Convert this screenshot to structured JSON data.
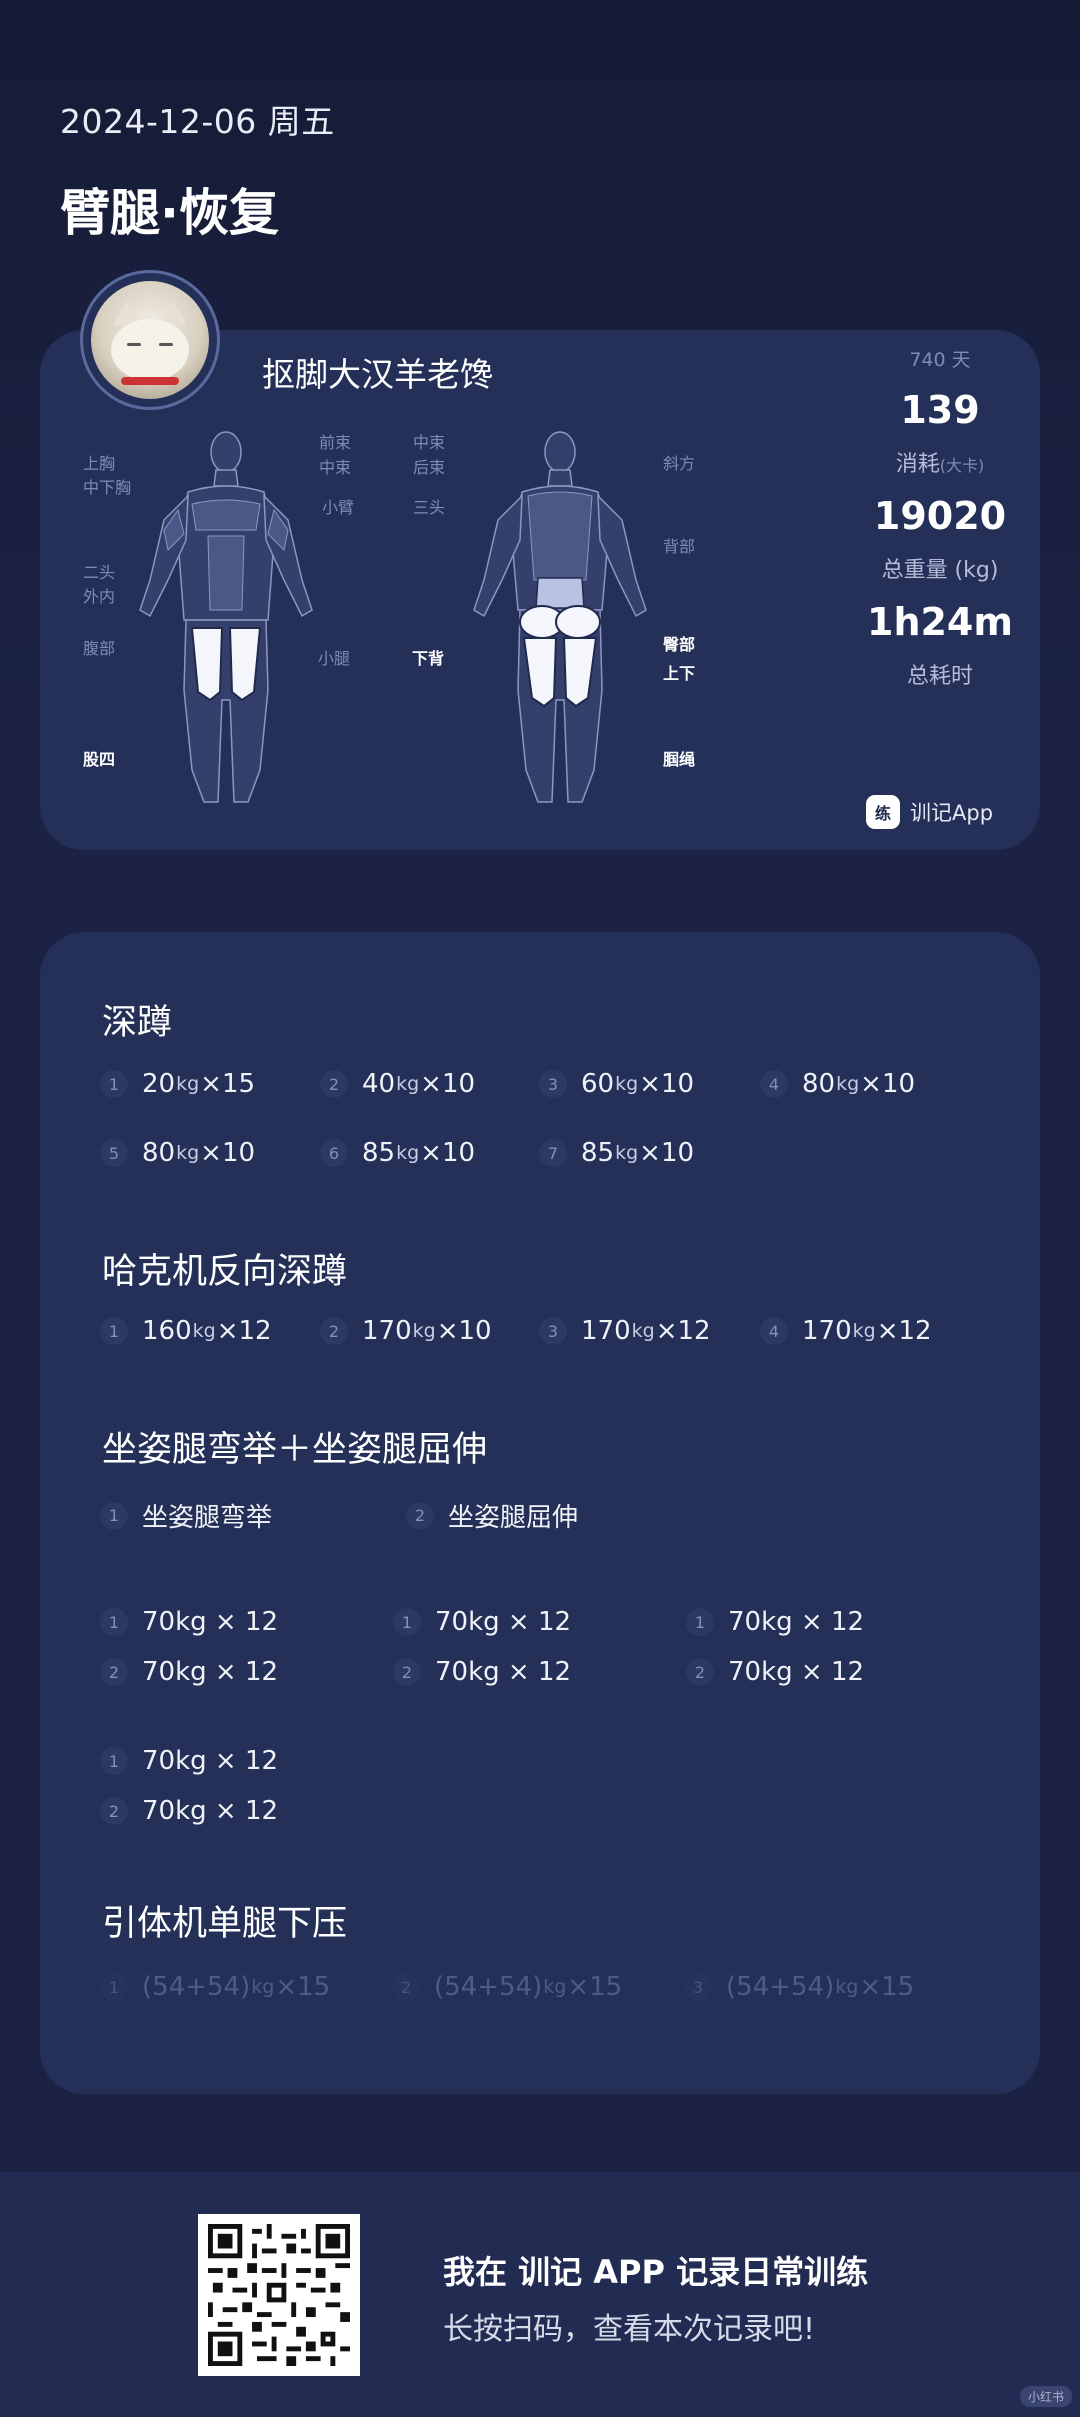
{
  "header": {
    "date": "2024-12-06 周五",
    "title": "臂腿·恢复"
  },
  "profile": {
    "username": "抠脚大汉羊老馋"
  },
  "muscle_labels": {
    "front_left": [
      "上胸",
      "中下胸",
      "二头",
      "外内",
      "腹部",
      "股四"
    ],
    "front_right": [
      "前束",
      "中束",
      "小臂",
      "小腿"
    ],
    "back_left": [
      "中束",
      "后束",
      "三头",
      "下背"
    ],
    "back_right": [
      "斜方",
      "背部",
      "臀部",
      "上下",
      "腘绳"
    ],
    "highlighted": [
      "股四",
      "下背",
      "臀部",
      "腘绳"
    ]
  },
  "stats": {
    "days": "740 天",
    "calories": "139",
    "calories_label": "消耗",
    "calories_unit": "(大卡)",
    "weight": "19020",
    "weight_label": "总重量 (kg)",
    "duration": "1h24m",
    "duration_label": "总耗时"
  },
  "brand": {
    "logo_text": "练",
    "name": "训记App"
  },
  "exercises": [
    {
      "title": "深蹲",
      "sets": [
        {
          "n": "1",
          "w": "20",
          "u": "kg",
          "r": "×15"
        },
        {
          "n": "2",
          "w": "40",
          "u": "kg",
          "r": "×10"
        },
        {
          "n": "3",
          "w": "60",
          "u": "kg",
          "r": "×10"
        },
        {
          "n": "4",
          "w": "80",
          "u": "kg",
          "r": "×10"
        },
        {
          "n": "5",
          "w": "80",
          "u": "kg",
          "r": "×10"
        },
        {
          "n": "6",
          "w": "85",
          "u": "kg",
          "r": "×10"
        },
        {
          "n": "7",
          "w": "85",
          "u": "kg",
          "r": "×10"
        }
      ]
    },
    {
      "title": "哈克机反向深蹲",
      "sets": [
        {
          "n": "1",
          "w": "160",
          "u": "kg",
          "r": "×12"
        },
        {
          "n": "2",
          "w": "170",
          "u": "kg",
          "r": "×10"
        },
        {
          "n": "3",
          "w": "170",
          "u": "kg",
          "r": "×12"
        },
        {
          "n": "4",
          "w": "170",
          "u": "kg",
          "r": "×12"
        }
      ]
    },
    {
      "title": "坐姿腿弯举＋坐姿腿屈伸",
      "sub_exercises": [
        {
          "n": "1",
          "name": "坐姿腿弯举"
        },
        {
          "n": "2",
          "name": "坐姿腿屈伸"
        }
      ],
      "groups": [
        [
          {
            "n": "1",
            "text": "70kg × 12"
          },
          {
            "n": "2",
            "text": "70kg × 12"
          }
        ],
        [
          {
            "n": "1",
            "text": "70kg × 12"
          },
          {
            "n": "2",
            "text": "70kg × 12"
          }
        ],
        [
          {
            "n": "1",
            "text": "70kg × 12"
          },
          {
            "n": "2",
            "text": "70kg × 12"
          }
        ],
        [
          {
            "n": "1",
            "text": "70kg × 12"
          },
          {
            "n": "2",
            "text": "70kg × 12"
          }
        ]
      ]
    },
    {
      "title": "引体机单腿下压",
      "sets": [
        {
          "n": "1",
          "w": "(54+54)",
          "u": "kg",
          "r": "×15"
        },
        {
          "n": "2",
          "w": "(54+54)",
          "u": "kg",
          "r": "×15"
        },
        {
          "n": "3",
          "w": "(54+54)",
          "u": "kg",
          "r": "×15"
        }
      ]
    }
  ],
  "footer": {
    "line1": "我在 训记 APP 记录日常训练",
    "line2": "长按扫码，查看本次记录吧!",
    "badge": "小红书"
  },
  "colors": {
    "background": "#1b2244",
    "card": "#243057",
    "muted_text": "#7f8bb3",
    "highlight_muscle": "#ffffff",
    "muscle_base": "#4a5888"
  }
}
